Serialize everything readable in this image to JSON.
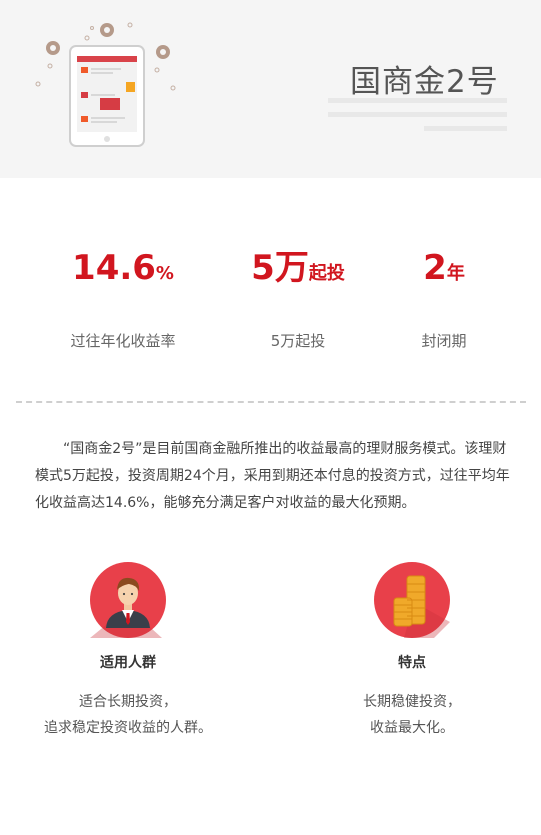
{
  "hero": {
    "title": "国商金2号"
  },
  "stats": [
    {
      "value": "14.6",
      "unit": "%",
      "label": "过往年化收益率"
    },
    {
      "value": "5万",
      "unit": "起投",
      "label": "5万起投"
    },
    {
      "value": "2",
      "unit": "年",
      "label": "封闭期"
    }
  ],
  "description": "“国商金2号”是目前国商金融所推出的收益最高的理财服务模式。该理财模式5万起投，投资周期24个月，采用到期还本付息的投资方式，过往平均年化收益高达14.6%，能够充分满足客户对收益的最大化预期。",
  "features": [
    {
      "icon": "person-icon",
      "title": "适用人群",
      "line1": "适合长期投资，",
      "line2": "追求稳定投资收益的人群。"
    },
    {
      "icon": "coins-icon",
      "title": "特点",
      "line1": "长期稳健投资，",
      "line2": "收益最大化。"
    }
  ],
  "colors": {
    "accent": "#d1161f",
    "circle": "#e8404a",
    "gold": "#f0a92a"
  }
}
